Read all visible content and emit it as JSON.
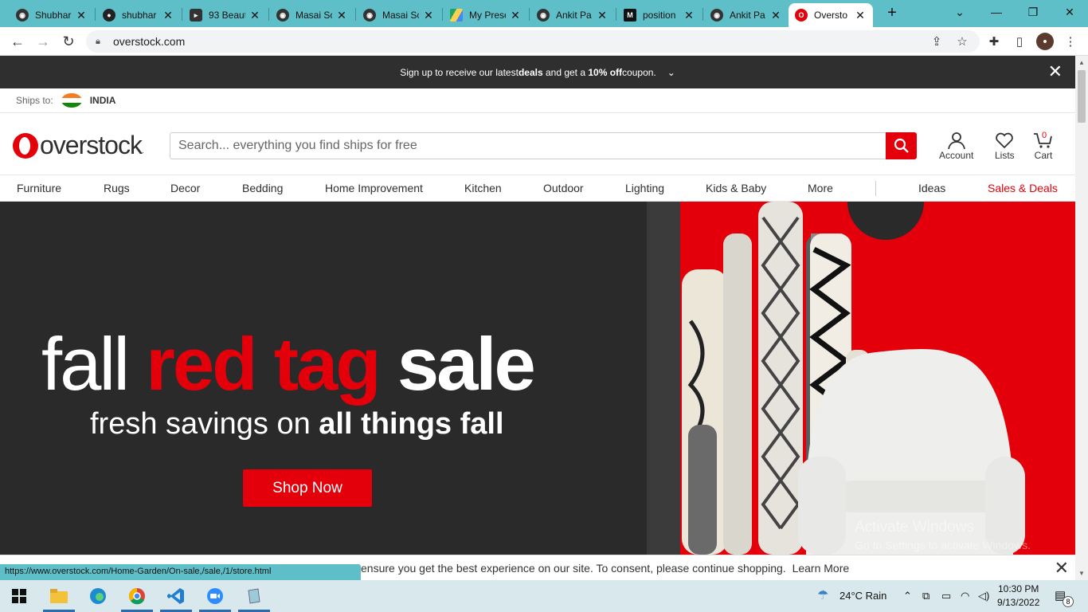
{
  "browser": {
    "tabs": [
      {
        "title": "Shubhar",
        "icon": "github-icon",
        "active": false
      },
      {
        "title": "shubhar",
        "icon": "github-icon",
        "active": false
      },
      {
        "title": "93 Beaut",
        "icon": "bookmark-icon",
        "active": false
      },
      {
        "title": "Masai Sc",
        "icon": "globe-icon",
        "active": false
      },
      {
        "title": "Masai Sc",
        "icon": "globe-icon",
        "active": false
      },
      {
        "title": "My Prese",
        "icon": "google-drive-icon",
        "active": false
      },
      {
        "title": "Ankit Pa",
        "icon": "globe-icon",
        "active": false
      },
      {
        "title": "position",
        "icon": "medium-icon",
        "active": false
      },
      {
        "title": "Ankit Pa",
        "icon": "globe-icon",
        "active": false
      },
      {
        "title": "Oversto",
        "icon": "overstock-icon",
        "active": true
      }
    ],
    "url": "overstock.com",
    "status_url": "https://www.overstock.com/Home-Garden/On-sale,/sale,/1/store.html",
    "accent": "#5fbfc8"
  },
  "promo": {
    "text_before": "Sign up to receive our latest ",
    "deals": "deals",
    "text_mid": " and get a ",
    "coupon": "10% off",
    "text_after": " coupon."
  },
  "ship": {
    "label": "Ships to:",
    "country": "INDIA"
  },
  "header": {
    "logo_text": "overstock",
    "logo_tm": ".",
    "search_placeholder": "Search... everything you find ships for free",
    "account_label": "Account",
    "lists_label": "Lists",
    "cart_label": "Cart",
    "cart_count": "0",
    "brand_color": "#e3000b"
  },
  "categories": [
    "Furniture",
    "Rugs",
    "Decor",
    "Bedding",
    "Home Improvement",
    "Kitchen",
    "Outdoor",
    "Lighting",
    "Kids & Baby",
    "More"
  ],
  "nav_right": {
    "ideas": "Ideas",
    "sales": "Sales & Deals"
  },
  "hero": {
    "word1": "fall",
    "word2": "red tag",
    "word3": "sale",
    "sub_prefix": "fresh savings on ",
    "sub_bold": "all things fall",
    "cta": "Shop Now"
  },
  "watermark": {
    "line1": "Activate Windows",
    "line2": "Go to Settings to activate Windows."
  },
  "consent": {
    "text": "ensure you get the best experience on our site. To consent, please continue shopping.",
    "link": "Learn More"
  },
  "taskbar": {
    "weather": "24°C  Rain",
    "time": "10:30 PM",
    "date": "9/13/2022",
    "notifications": "8"
  }
}
